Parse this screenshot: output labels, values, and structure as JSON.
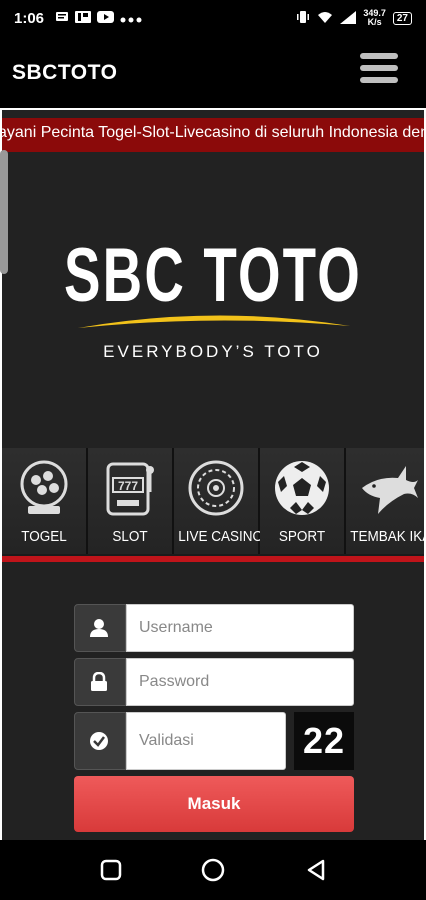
{
  "status_bar": {
    "time": "1:06",
    "net_speed": "349.7",
    "net_unit": "K/s",
    "battery": "27",
    "icons": [
      "message-icon",
      "p-app-icon",
      "youtube-icon",
      "more-dots-icon",
      "vibrate-icon",
      "wifi-icon",
      "signal-icon",
      "battery-icon"
    ]
  },
  "app_bar": {
    "title": "SBCTOTO",
    "menu_icon": "hamburger-menu-icon"
  },
  "marquee": {
    "text": "ayani Pecinta Togel-Slot-Livecasino di seluruh Indonesia den"
  },
  "logo": {
    "text": "SBC TOTO",
    "tagline": "EVERYBODY’S TOTO"
  },
  "games": [
    {
      "label": "TOGEL",
      "icon": "lottery-ball-icon"
    },
    {
      "label": "SLOT",
      "icon": "slot-machine-icon"
    },
    {
      "label": "LIVE CASINO",
      "icon": "roulette-icon"
    },
    {
      "label": "SPORT",
      "icon": "soccer-ball-icon"
    },
    {
      "label": "TEMBAK IKAN",
      "icon": "shark-icon"
    }
  ],
  "login": {
    "username_placeholder": "Username",
    "password_placeholder": "Password",
    "validation_placeholder": "Validasi",
    "captcha": "22",
    "submit_label": "Masuk"
  },
  "colors": {
    "marquee_bg": "#8b0a0a",
    "accent_red": "#c0141a",
    "submit_bg": "#e24a4a",
    "page_bg": "#222222"
  }
}
